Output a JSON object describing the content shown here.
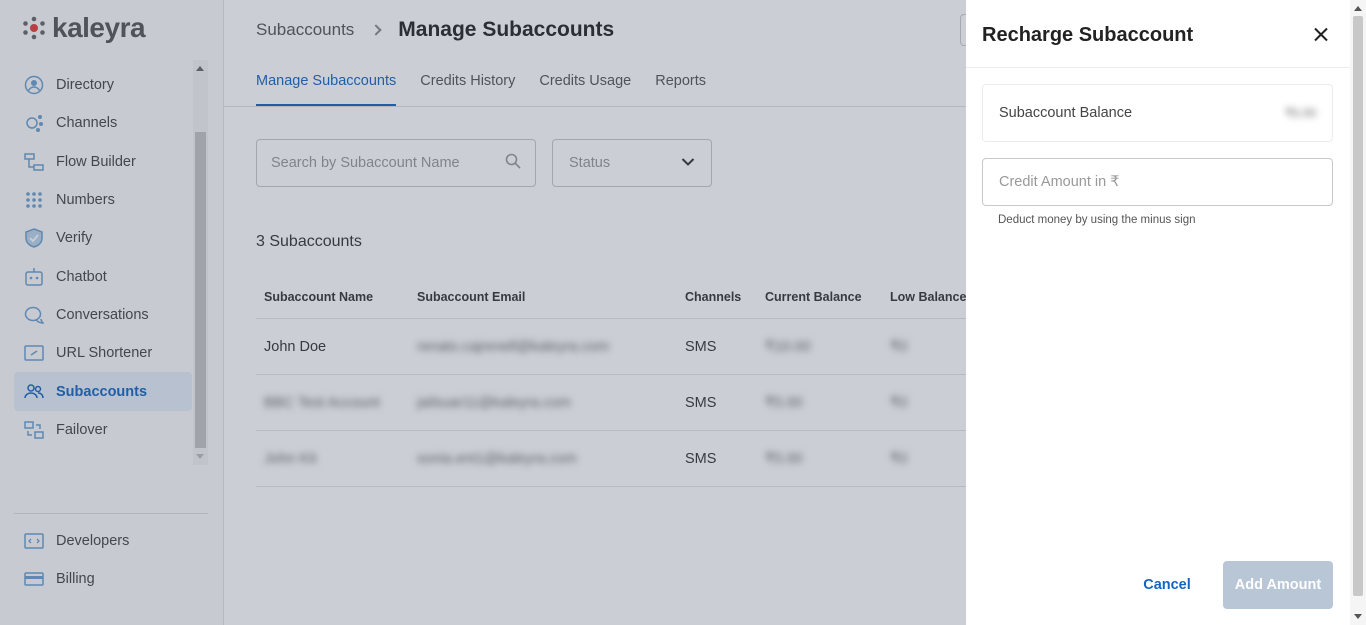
{
  "brand": {
    "name": "kaleyra"
  },
  "sidebar": {
    "items": [
      {
        "label": "Directory",
        "icon": "directory-icon"
      },
      {
        "label": "Channels",
        "icon": "channels-icon"
      },
      {
        "label": "Flow Builder",
        "icon": "flow-builder-icon"
      },
      {
        "label": "Numbers",
        "icon": "numbers-icon"
      },
      {
        "label": "Verify",
        "icon": "verify-shield-icon"
      },
      {
        "label": "Chatbot",
        "icon": "chatbot-icon"
      },
      {
        "label": "Conversations",
        "icon": "conversations-icon"
      },
      {
        "label": "URL Shortener",
        "icon": "url-shortener-icon"
      },
      {
        "label": "Subaccounts",
        "icon": "subaccounts-icon",
        "active": true
      },
      {
        "label": "Failover",
        "icon": "failover-icon"
      }
    ],
    "bottom_items": [
      {
        "label": "Developers",
        "icon": "developers-icon"
      },
      {
        "label": "Billing",
        "icon": "billing-icon"
      }
    ]
  },
  "header": {
    "breadcrumb_parent": "Subaccounts",
    "title": "Manage Subaccounts"
  },
  "tabs": [
    {
      "label": "Manage Subaccounts",
      "active": true
    },
    {
      "label": "Credits History"
    },
    {
      "label": "Credits Usage"
    },
    {
      "label": "Reports"
    }
  ],
  "filters": {
    "search_placeholder": "Search by Subaccount Name",
    "status_placeholder": "Status"
  },
  "table": {
    "count_label": "3 Subaccounts",
    "columns": [
      "Subaccount Name",
      "Subaccount Email",
      "Channels",
      "Current Balance",
      "Low Balance"
    ],
    "rows": [
      {
        "name": "John Doe",
        "email": "renato.cajrenell@kaleyra.com",
        "channel": "SMS",
        "balance": "₹10.00",
        "low": "₹0"
      },
      {
        "name": "BBC Test Account",
        "email": "jailsuar11@kaleyra.com",
        "channel": "SMS",
        "balance": "₹5.00",
        "low": "₹0"
      },
      {
        "name": "John Kit",
        "email": "sonia.ent1@kaleyra.com",
        "channel": "SMS",
        "balance": "₹5.00",
        "low": "₹0"
      }
    ]
  },
  "drawer": {
    "title": "Recharge Subaccount",
    "balance_label": "Subaccount Balance",
    "balance_value": "₹5.00",
    "credit_placeholder": "Credit Amount in ₹",
    "hint": "Deduct money by using the minus sign",
    "cancel_label": "Cancel",
    "add_label": "Add Amount"
  },
  "colors": {
    "accent": "#1565c0",
    "disabled_button": "#b8c6d6",
    "overlay": "rgba(70,80,100,0.28)"
  }
}
